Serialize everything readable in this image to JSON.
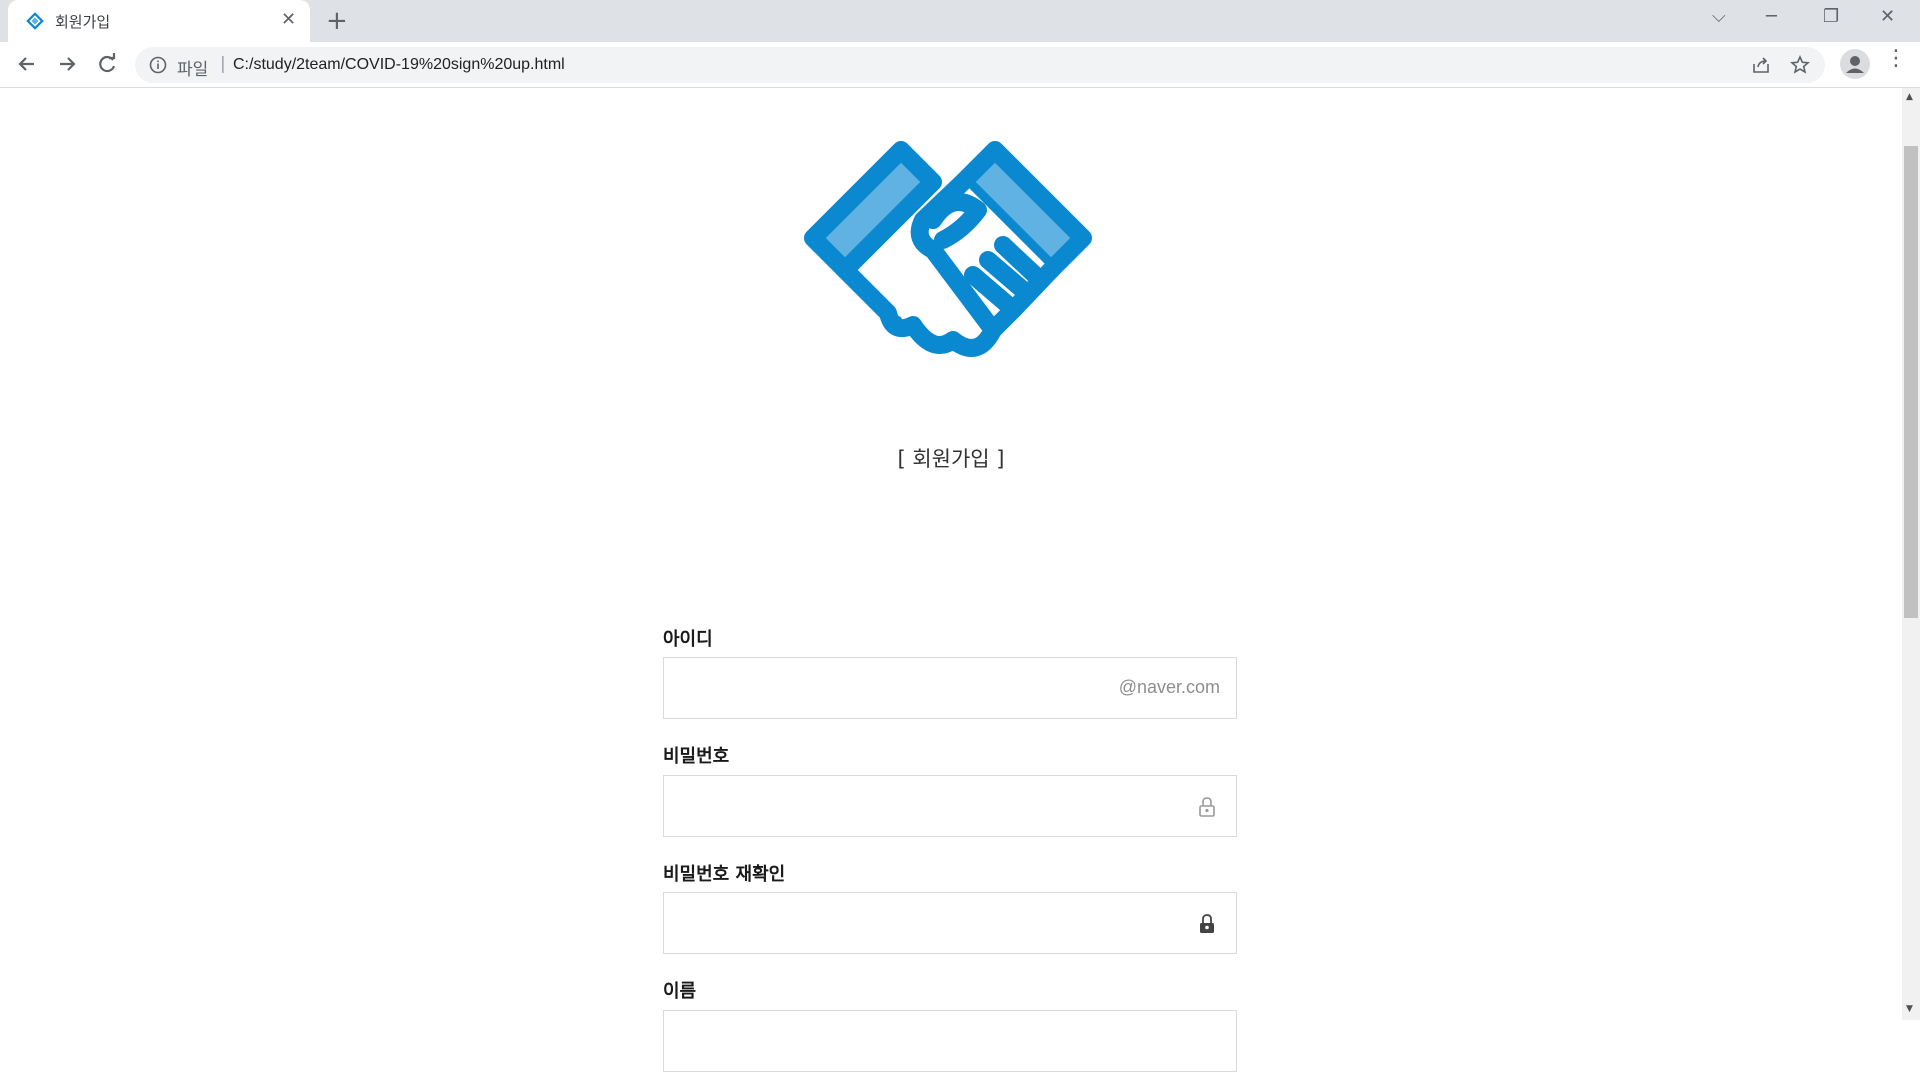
{
  "browser": {
    "tab_title": "회원가입",
    "tab_close": "✕",
    "new_tab": "+",
    "scheme_label": "파일",
    "separator": "|",
    "url": "C:/study/2team/COVID-19%20sign%20up.html",
    "window_controls": {
      "tab_search": "⌵",
      "minimize": "─",
      "restore": "❐",
      "close": "✕"
    },
    "menu": "⋮"
  },
  "page": {
    "logo": "handshake-logo",
    "heading": "[ 회원가입 ]",
    "fields": [
      {
        "label": "아이디",
        "suffix": "@naver.com"
      },
      {
        "label": "비밀번호",
        "icon": "lock-open-icon"
      },
      {
        "label": "비밀번호 재확인",
        "icon": "lock-closed-icon"
      },
      {
        "label": "이름"
      }
    ]
  },
  "colors": {
    "brand_blue": "#0a88d0",
    "brand_light": "#5fb2e2"
  }
}
